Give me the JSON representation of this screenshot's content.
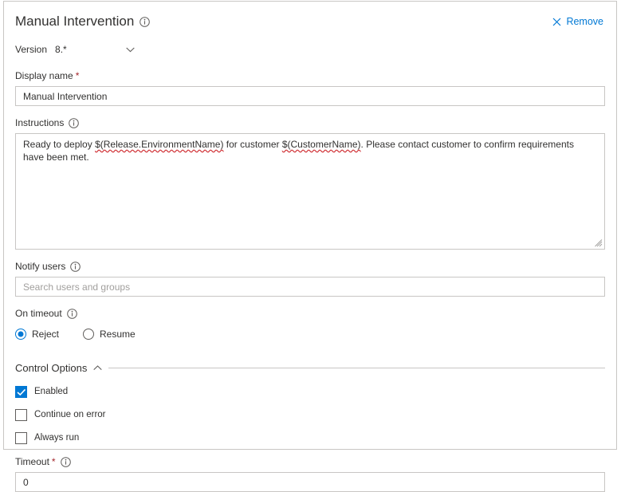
{
  "header": {
    "title": "Manual Intervention",
    "info_icon": "info-icon",
    "remove_label": "Remove",
    "remove_icon": "close-icon"
  },
  "version": {
    "label": "Version",
    "value": "8.*",
    "chevron_icon": "chevron-down-icon"
  },
  "display_name": {
    "label": "Display name",
    "required": "*",
    "value": "Manual Intervention"
  },
  "instructions": {
    "label": "Instructions",
    "info_icon": "info-icon",
    "part1": "Ready to deploy ",
    "token1": "$(Release.EnvironmentName)",
    "part2": " for customer ",
    "token2": "$(CustomerName)",
    "part3": ". Please contact customer to confirm requirements have been met.",
    "resize_icon": "resize-grip-icon"
  },
  "notify_users": {
    "label": "Notify users",
    "info_icon": "info-icon",
    "value": "",
    "placeholder": "Search users and groups"
  },
  "on_timeout": {
    "label": "On timeout",
    "info_icon": "info-icon",
    "options": [
      {
        "label": "Reject",
        "selected": true
      },
      {
        "label": "Resume",
        "selected": false
      }
    ]
  },
  "control_options": {
    "title": "Control Options",
    "chevron_icon": "chevron-up-icon",
    "checkboxes": [
      {
        "label": "Enabled",
        "checked": true
      },
      {
        "label": "Continue on error",
        "checked": false
      },
      {
        "label": "Always run",
        "checked": false
      }
    ]
  },
  "timeout": {
    "label": "Timeout",
    "required": "*",
    "info_icon": "info-icon",
    "value": "0"
  },
  "colors": {
    "accent": "#0078d4",
    "required": "#a4262c",
    "border": "#c8c6c4",
    "text": "#323130",
    "placeholder": "#a19f9d",
    "spellcheck": "#d13438"
  }
}
